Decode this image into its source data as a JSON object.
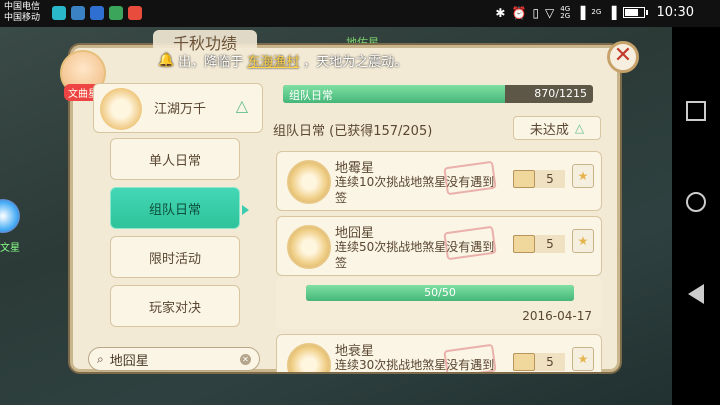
{
  "status_bar": {
    "carrier_1": "中国电信",
    "carrier_2": "中国移动",
    "app_icon_colors": [
      "#2ab7ca",
      "#3b82c4",
      "#2f6fd1",
      "#3ca55c",
      "#e74c3c"
    ],
    "network_1": "4G",
    "network_2": "2G",
    "network_3": "2G",
    "battery_fraction": 0.8,
    "time": "10:30"
  },
  "game": {
    "background_label": "地佑星",
    "left_side_label": "文星",
    "panel_title": "千秋功绩",
    "announcement": {
      "prefix": "出，降临于",
      "place": "东海渔村",
      "suffix": "，天地为之震动。"
    },
    "avatar_tag": "文曲星",
    "category": {
      "label": "江湖万千"
    },
    "side_buttons": [
      {
        "label": "单人日常",
        "active": false
      },
      {
        "label": "组队日常",
        "active": true
      },
      {
        "label": "限时活动",
        "active": false
      },
      {
        "label": "玩家对决",
        "active": false
      }
    ],
    "search": {
      "value": "地囧星"
    },
    "top_progress": {
      "name": "组队日常",
      "count": "870/1215",
      "fraction": 0.716
    },
    "section": {
      "title": "组队日常 (已获得157/205)",
      "status_label": "未达成"
    },
    "achievements": [
      {
        "name": "地霉星",
        "desc": "连续10次挑战地煞星没有遇到签",
        "reward": "5"
      },
      {
        "name": "地囧星",
        "desc": "连续50次挑战地煞星没有遇到签",
        "reward": "5"
      },
      {
        "name": "地衰星",
        "desc": "连续30次挑战地煞星没有遇到签",
        "reward": "5"
      }
    ],
    "sub_progress": {
      "text": "50/50",
      "fraction": 1.0,
      "date": "2016-04-17"
    }
  }
}
